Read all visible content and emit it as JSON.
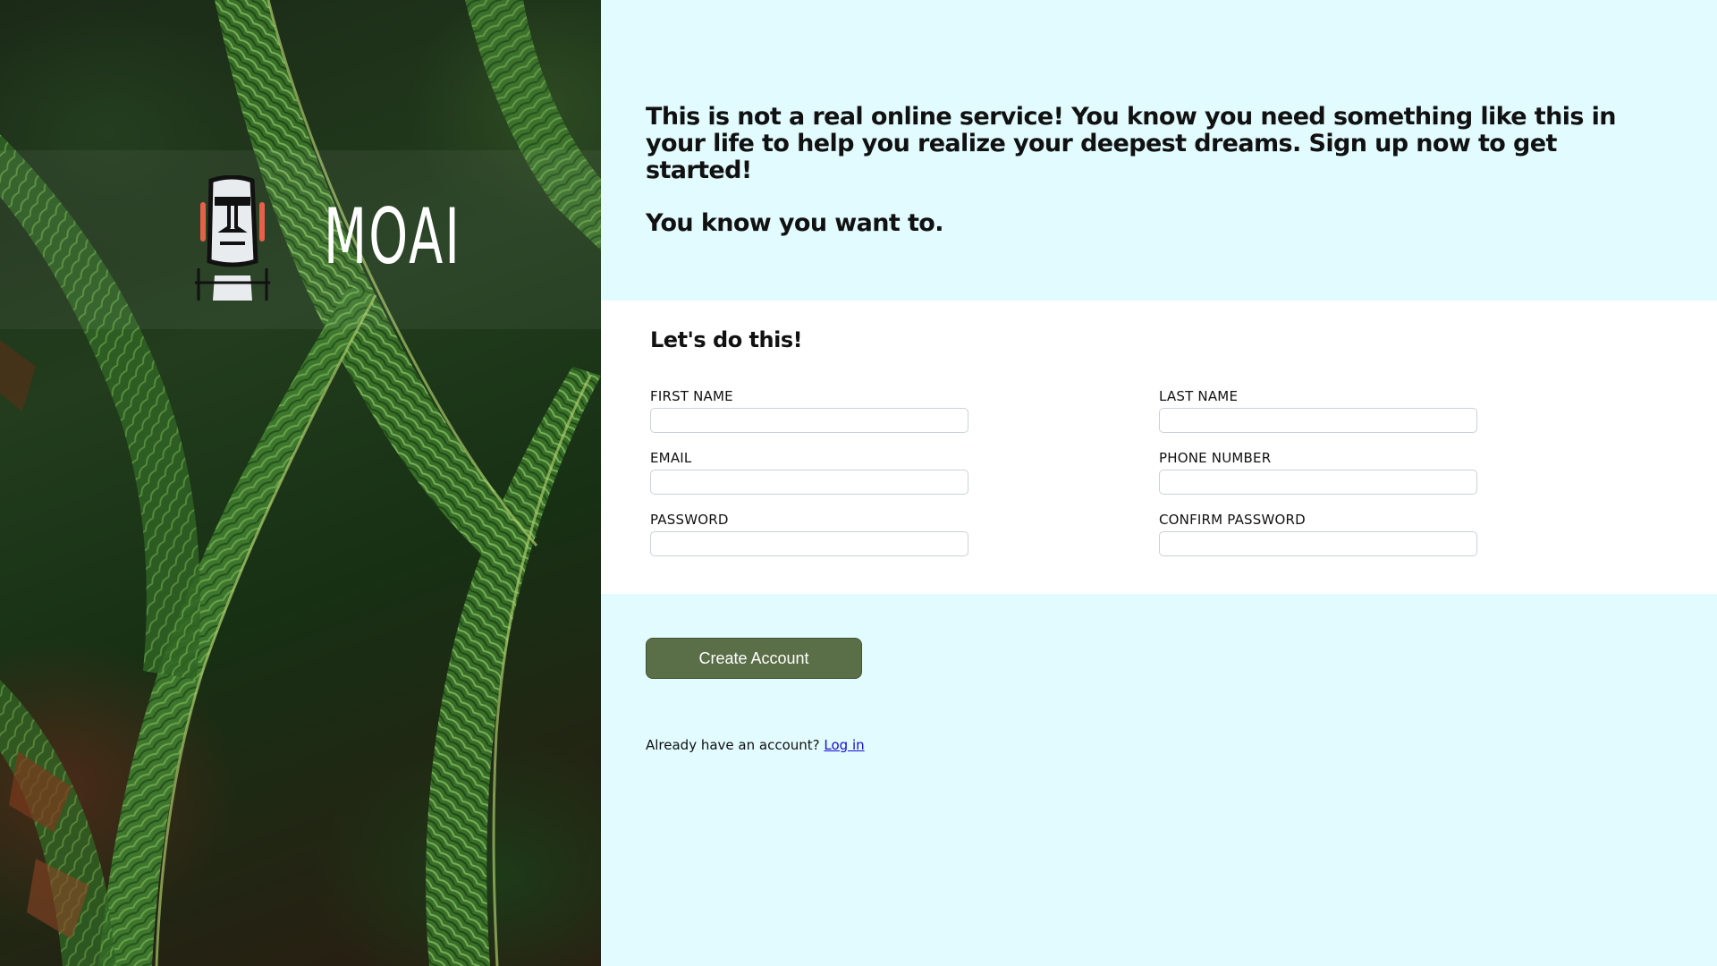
{
  "brand": {
    "name": "MOAI",
    "logo_icon": "moai-statue-icon"
  },
  "intro": {
    "paragraph_1": "This is not a real online service! You know you need something like this in your life to help you realize your deepest dreams. Sign up now to get started!",
    "paragraph_2": "You know you want to."
  },
  "form": {
    "heading": "Let's do this!",
    "fields": {
      "first_name": {
        "label": "FIRST NAME",
        "value": ""
      },
      "last_name": {
        "label": "LAST NAME",
        "value": ""
      },
      "email": {
        "label": "EMAIL",
        "value": ""
      },
      "phone": {
        "label": "PHONE NUMBER",
        "value": ""
      },
      "password": {
        "label": "PASSWORD",
        "value": ""
      },
      "confirm_password": {
        "label": "CONFIRM PASSWORD",
        "value": ""
      }
    }
  },
  "actions": {
    "create_account_label": "Create Account",
    "login_prompt": "Already have an account?",
    "login_link": "Log in"
  },
  "colors": {
    "panel_background": "#e1fbff",
    "button_green": "#5a6e47",
    "link_blue": "#1a0dce"
  }
}
